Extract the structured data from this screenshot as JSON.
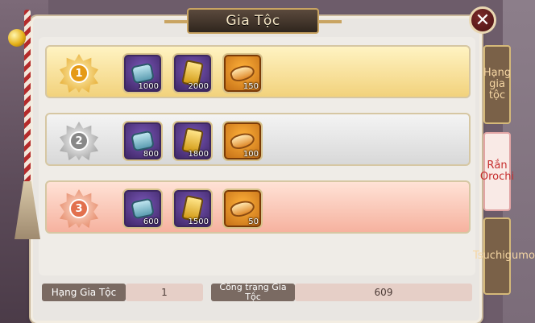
{
  "window": {
    "title": "Gia Tộc",
    "close_icon": "close-icon"
  },
  "tabs": [
    {
      "label": "Hạng gia tộc",
      "active": false
    },
    {
      "label": "Rắn Orochi",
      "active": true
    },
    {
      "label": "Tsuchigumo",
      "active": false
    }
  ],
  "ranks": [
    {
      "rank": "1",
      "medal": "gold",
      "rewards": [
        {
          "icon": "coin-icon",
          "qty": "1000"
        },
        {
          "icon": "token-icon",
          "qty": "2000"
        },
        {
          "icon": "bread-icon",
          "qty": "150"
        }
      ]
    },
    {
      "rank": "2",
      "medal": "silver",
      "rewards": [
        {
          "icon": "coin-icon",
          "qty": "800"
        },
        {
          "icon": "token-icon",
          "qty": "1800"
        },
        {
          "icon": "bread-icon",
          "qty": "100"
        }
      ]
    },
    {
      "rank": "3",
      "medal": "bronze",
      "rewards": [
        {
          "icon": "coin-icon",
          "qty": "600"
        },
        {
          "icon": "token-icon",
          "qty": "1500"
        },
        {
          "icon": "bread-icon",
          "qty": "50"
        }
      ]
    }
  ],
  "footer": {
    "rank_label": "Hạng Gia Tộc",
    "rank_value": "1",
    "merit_label": "Công trạng Gia Tộc",
    "merit_value": "609"
  },
  "colors": {
    "gold_row": "#f2d27c",
    "silver_row": "#d8d8d8",
    "bronze_row": "#f6b29f",
    "active_tab_text": "#c62d2d"
  }
}
